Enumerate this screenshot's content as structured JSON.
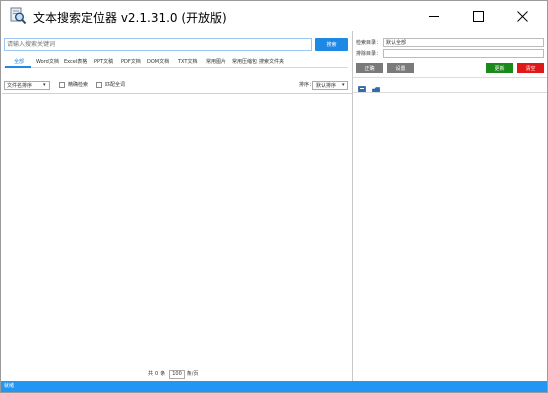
{
  "window": {
    "title": "文本搜索定位器 v2.1.31.0 (开放版)"
  },
  "search": {
    "placeholder": "请输入搜索关键词",
    "button_label": "搜索"
  },
  "tabs": [
    "全部",
    "Word文档",
    "Excel表格",
    "PPT文稿",
    "PDF文档",
    "DOM文档",
    "TXT文档",
    "常用图片",
    "常用压缩包",
    "搜索文件夹"
  ],
  "active_tab": 0,
  "filter": {
    "sort_select": "文件名排序",
    "option1_label": "精确检索",
    "option2_label": "匹配全词",
    "order_label": "排序：",
    "order_select": "默认排序"
  },
  "pagination": {
    "total_prefix": "共",
    "total_value": "0",
    "total_suffix": "条",
    "page_size": "100",
    "page_size_suffix": "条/页"
  },
  "right_panel": {
    "field1_label": "检索目录：",
    "field1_value": "默认全部",
    "field2_label": "排除目录：",
    "field2_value": "",
    "btn_confirm": "正确",
    "btn_reset": "设置",
    "btn_green": "更新",
    "btn_red": "清空"
  },
  "status": {
    "text": "就绪"
  },
  "colors": {
    "accent": "#1e88e5",
    "status_bar": "#2196f3",
    "green": "#1b8a1b",
    "red": "#e01818",
    "gray_btn": "#7a7a7a"
  }
}
